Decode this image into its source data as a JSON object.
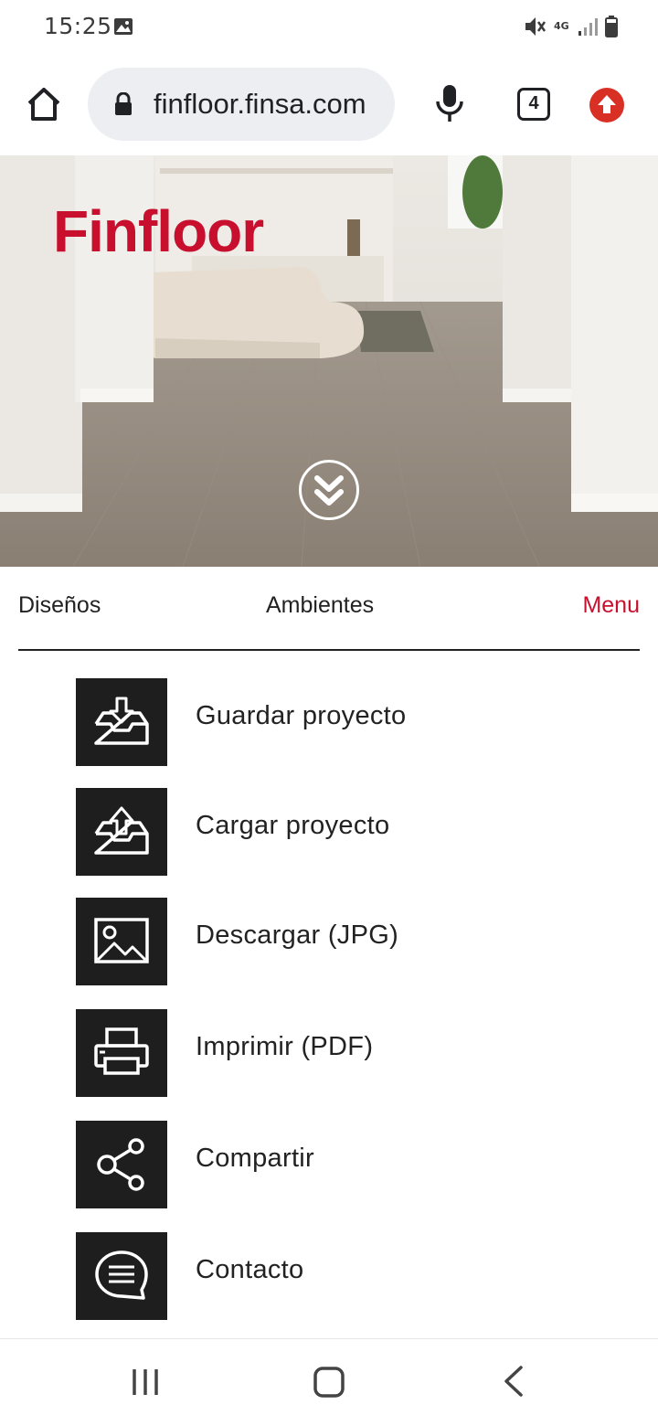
{
  "status_bar": {
    "time": "15:25",
    "network": "4G",
    "icons": [
      "image-icon",
      "mute-icon",
      "signal-icon",
      "battery-icon"
    ]
  },
  "browser": {
    "url": "finfloor.finsa.com",
    "tab_count": "4",
    "icons": [
      "home-icon",
      "lock-icon",
      "mic-icon",
      "update-icon"
    ]
  },
  "hero": {
    "brand": "Finfloor",
    "brand_color": "#c8102e"
  },
  "tabs": {
    "disenos": "Diseños",
    "ambientes": "Ambientes",
    "menu": "Menu",
    "active": "Menu"
  },
  "menu": {
    "items": [
      {
        "label": "Guardar proyecto",
        "icon": "tray-download-icon"
      },
      {
        "label": "Cargar proyecto",
        "icon": "tray-upload-icon"
      },
      {
        "label": "Descargar (JPG)",
        "icon": "image-icon"
      },
      {
        "label": "Imprimir (PDF)",
        "icon": "printer-icon"
      },
      {
        "label": "Compartir",
        "icon": "share-icon"
      },
      {
        "label": "Contacto",
        "icon": "chat-bubble-icon"
      }
    ]
  },
  "colors": {
    "accent": "#c8102e",
    "icon_box": "#1e1e1e",
    "update_button": "#d93025"
  }
}
